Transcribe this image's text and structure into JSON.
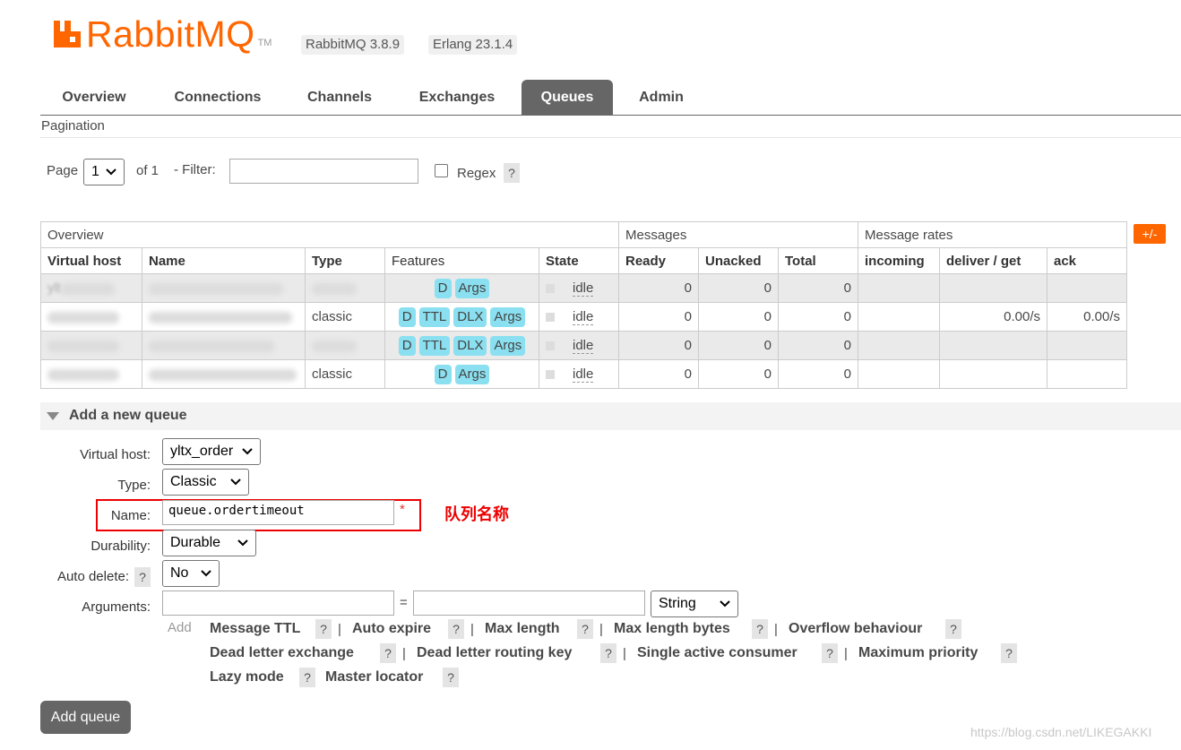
{
  "header": {
    "logo_text": "RabbitMQ",
    "logo_tm": "TM",
    "version": "RabbitMQ 3.8.9",
    "erlang": "Erlang 23.1.4",
    "brand_color": "#ff6600"
  },
  "nav": {
    "tabs": [
      {
        "label": "Overview"
      },
      {
        "label": "Connections"
      },
      {
        "label": "Channels"
      },
      {
        "label": "Exchanges"
      },
      {
        "label": "Queues",
        "active": true
      },
      {
        "label": "Admin"
      }
    ]
  },
  "pagination": {
    "title": "Pagination",
    "page_label": "Page",
    "page_value": "1",
    "of_label": "of 1",
    "filter_label": "- Filter:",
    "filter_value": "",
    "regex_label": "Regex",
    "help": "?"
  },
  "table": {
    "toggle": "+/-",
    "groups": [
      "Overview",
      "Messages",
      "Message rates"
    ],
    "columns": [
      "Virtual host",
      "Name",
      "Type",
      "Features",
      "State",
      "Ready",
      "Unacked",
      "Total",
      "incoming",
      "deliver / get",
      "ack"
    ],
    "rows": [
      {
        "vhost": "ylt",
        "type": "",
        "features": [
          "D",
          "Args"
        ],
        "state": "idle",
        "ready": "0",
        "unacked": "0",
        "total": "0",
        "incoming": "",
        "deliver_get": "",
        "ack": ""
      },
      {
        "vhost": "",
        "type": "classic",
        "features": [
          "D",
          "TTL",
          "DLX",
          "Args"
        ],
        "state": "idle",
        "ready": "0",
        "unacked": "0",
        "total": "0",
        "incoming": "",
        "deliver_get": "0.00/s",
        "ack": "0.00/s"
      },
      {
        "vhost": "",
        "type": "",
        "features": [
          "D",
          "TTL",
          "DLX",
          "Args"
        ],
        "state": "idle",
        "ready": "0",
        "unacked": "0",
        "total": "0",
        "incoming": "",
        "deliver_get": "",
        "ack": ""
      },
      {
        "vhost": "",
        "type": "classic",
        "features": [
          "D",
          "Args"
        ],
        "state": "idle",
        "ready": "0",
        "unacked": "0",
        "total": "0",
        "incoming": "",
        "deliver_get": "",
        "ack": ""
      }
    ]
  },
  "add_queue": {
    "title": "Add a new queue",
    "vhost_label": "Virtual host:",
    "vhost_value": "yltx_order",
    "type_label": "Type:",
    "type_value": "Classic",
    "name_label": "Name:",
    "name_value": "queue.ordertimeout",
    "required_mark": "*",
    "annotation": "队列名称",
    "durability_label": "Durability:",
    "durability_value": "Durable",
    "autodelete_label": "Auto delete:",
    "autodelete_value": "No",
    "arguments_label": "Arguments:",
    "arg_equals": "=",
    "arg_type_value": "String",
    "add_label": "Add",
    "arg_links": [
      "Message TTL",
      "Auto expire",
      "Max length",
      "Max length bytes",
      "Overflow behaviour",
      "Dead letter exchange",
      "Dead letter routing key",
      "Single active consumer",
      "Maximum priority",
      "Lazy mode",
      "Master locator"
    ],
    "separator": "|",
    "help": "?",
    "submit_label": "Add queue"
  },
  "watermark": "https://blog.csdn.net/LIKEGAKKI"
}
